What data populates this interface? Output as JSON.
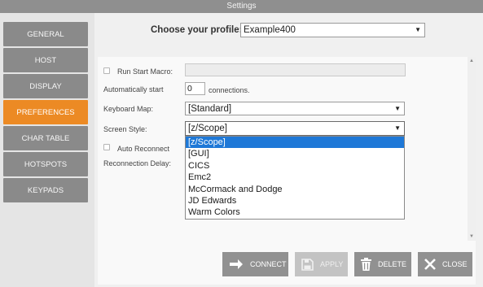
{
  "window": {
    "title": "Settings"
  },
  "sidebar": {
    "items": [
      {
        "label": "GENERAL",
        "active": false
      },
      {
        "label": "HOST",
        "active": false
      },
      {
        "label": "DISPLAY",
        "active": false
      },
      {
        "label": "PREFERENCES",
        "active": true
      },
      {
        "label": "CHAR TABLE",
        "active": false
      },
      {
        "label": "HOTSPOTS",
        "active": false
      },
      {
        "label": "KEYPADS",
        "active": false
      }
    ]
  },
  "profile": {
    "label": "Choose your profile:",
    "value": "Example400"
  },
  "preferences": {
    "run_start_macro_label": "Run Start Macro:",
    "run_start_macro_checked": false,
    "run_start_macro_value": "",
    "auto_start_label": "Automatically start",
    "auto_start_value": "0",
    "auto_start_suffix": "connections.",
    "keyboard_map_label": "Keyboard Map:",
    "keyboard_map_value": "[Standard]",
    "screen_style_label": "Screen Style:",
    "screen_style_value": "[z/Scope]",
    "auto_reconnect_label": "Auto Reconnect",
    "auto_reconnect_checked": false,
    "reconnection_delay_label": "Reconnection Delay:"
  },
  "screen_style_options": [
    "[z/Scope]",
    "[GUI]",
    "CICS",
    "Emc2",
    "McCormack and Dodge",
    "JD Edwards",
    "Warm Colors"
  ],
  "screen_style_selected_index": 0,
  "actions": {
    "connect": "CONNECT",
    "apply": "APPLY",
    "delete": "DELETE",
    "close": "CLOSE"
  },
  "colors": {
    "accent": "#ec8a24",
    "sidebar_button": "#8a8a8a",
    "selection": "#1e78d7"
  }
}
